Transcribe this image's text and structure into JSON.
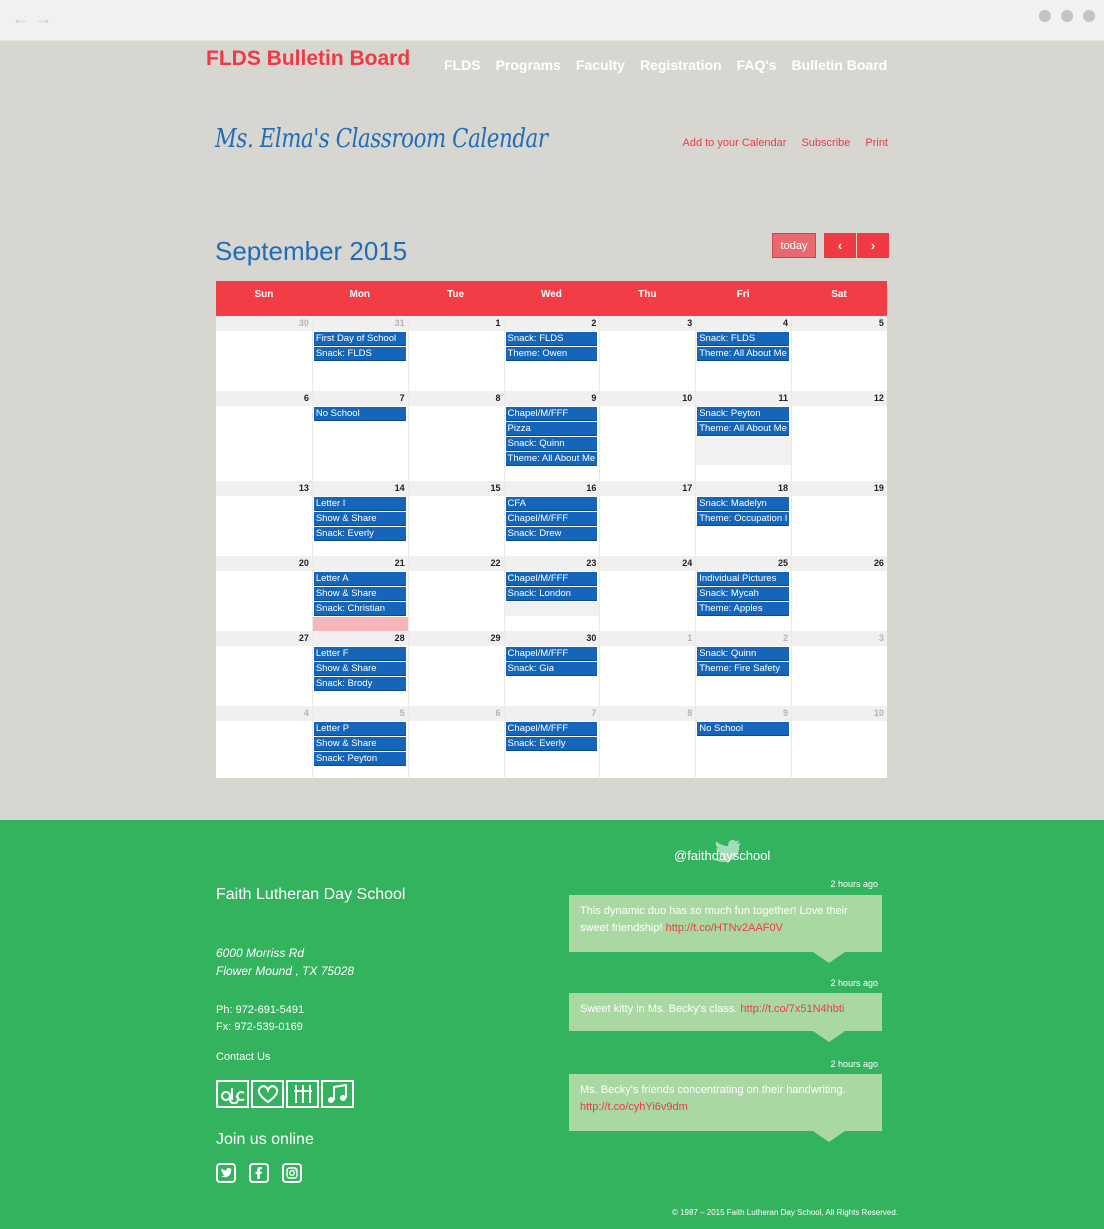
{
  "browser": {
    "back_icon": "←",
    "forward_icon": "→"
  },
  "header": {
    "site_title": "FLDS Bulletin Board",
    "nav": [
      "FLDS",
      "Programs",
      "Faculty",
      "Registration",
      "FAQ's",
      "Bulletin Board"
    ]
  },
  "page": {
    "heading": "Ms. Elma's Classroom Calendar",
    "links": [
      "Add to your Calendar",
      "Subscribe",
      "Print"
    ]
  },
  "calendar": {
    "month": "September 2015",
    "today_label": "today",
    "prev_label": "‹",
    "next_label": "›",
    "days_of_week": [
      "Sun",
      "Mon",
      "Tue",
      "Wed",
      "Thu",
      "Fri",
      "Sat"
    ],
    "weeks": [
      [
        {
          "n": "30",
          "other": true,
          "events": []
        },
        {
          "n": "31",
          "other": true,
          "events": [
            "First Day of School",
            "Snack: FLDS"
          ]
        },
        {
          "n": "1",
          "events": []
        },
        {
          "n": "2",
          "events": [
            "Snack: FLDS",
            "Theme: Owen"
          ]
        },
        {
          "n": "3",
          "events": []
        },
        {
          "n": "4",
          "events": [
            "Snack: FLDS",
            "Theme: All About Me"
          ]
        },
        {
          "n": "5",
          "events": []
        }
      ],
      [
        {
          "n": "6",
          "events": []
        },
        {
          "n": "7",
          "events": [
            "No School"
          ]
        },
        {
          "n": "8",
          "events": []
        },
        {
          "n": "9",
          "events": [
            "Chapel/M/FFF",
            "Pizza",
            "Snack: Quinn",
            "Theme: All About Me"
          ]
        },
        {
          "n": "10",
          "events": []
        },
        {
          "n": "11",
          "events": [
            "Snack: Peyton",
            "Theme: All About Me"
          ]
        },
        {
          "n": "12",
          "events": []
        }
      ],
      [
        {
          "n": "13",
          "events": []
        },
        {
          "n": "14",
          "events": [
            "Letter I",
            "Show & Share",
            "Snack: Everly"
          ]
        },
        {
          "n": "15",
          "events": []
        },
        {
          "n": "16",
          "events": [
            "CFA",
            "Chapel/M/FFF",
            "Snack: Drew"
          ]
        },
        {
          "n": "17",
          "events": []
        },
        {
          "n": "18",
          "events": [
            "Snack: Madelyn",
            "Theme: Occupation I"
          ]
        },
        {
          "n": "19",
          "events": []
        }
      ],
      [
        {
          "n": "20",
          "events": []
        },
        {
          "n": "21",
          "events": [
            "Letter A",
            "Show & Share",
            "Snack: Christian"
          ]
        },
        {
          "n": "22",
          "events": []
        },
        {
          "n": "23",
          "events": [
            "Chapel/M/FFF",
            "Snack: London"
          ]
        },
        {
          "n": "24",
          "events": []
        },
        {
          "n": "25",
          "events": [
            "Individual Pictures",
            "Snack: Mycah",
            "Theme: Apples"
          ]
        },
        {
          "n": "26",
          "events": []
        }
      ],
      [
        {
          "n": "27",
          "events": []
        },
        {
          "n": "28",
          "events": [
            "Letter F",
            "Show & Share",
            "Snack: Brody"
          ]
        },
        {
          "n": "29",
          "events": []
        },
        {
          "n": "30",
          "events": [
            "Chapel/M/FFF",
            "Snack: Gia"
          ]
        },
        {
          "n": "1",
          "other": true,
          "events": []
        },
        {
          "n": "2",
          "other": true,
          "events": [
            "Snack: Quinn",
            "Theme: Fire Safety"
          ]
        },
        {
          "n": "3",
          "other": true,
          "events": []
        }
      ],
      [
        {
          "n": "4",
          "other": true,
          "events": []
        },
        {
          "n": "5",
          "other": true,
          "events": [
            "Letter P",
            "Show & Share",
            "Snack: Peyton"
          ]
        },
        {
          "n": "6",
          "other": true,
          "events": []
        },
        {
          "n": "7",
          "other": true,
          "events": [
            "Chapel/M/FFF",
            "Snack: Everly"
          ]
        },
        {
          "n": "8",
          "other": true,
          "events": []
        },
        {
          "n": "9",
          "other": true,
          "events": [
            "No School"
          ]
        },
        {
          "n": "10",
          "other": true,
          "events": []
        }
      ]
    ]
  },
  "footer": {
    "school_name": "Faith Lutheran Day School",
    "address_line1": "6000 Morriss Rd",
    "address_line2": "Flower Mound , TX  75028",
    "phone": "Ph: 972-691-5491",
    "fax": "Fx: 972-539-0169",
    "contact": "Contact Us",
    "join": "Join us online",
    "twitter_handle": "@faithdayschool",
    "tweets": [
      {
        "time": "2 hours ago",
        "text": "This dynamic duo has so much fun together! Love their sweet friendship! ",
        "link": "http://t.co/HTNv2AAF0V"
      },
      {
        "time": "2 hours ago",
        "text": "Sweet kitty in Ms. Becky's class. ",
        "link": "http://t.co/7x51N4hbti"
      },
      {
        "time": "2 hours ago",
        "text": "Ms. Becky's friends concentrating on their handwriting. ",
        "link": "http://t.co/cyhYi6v9dm"
      }
    ],
    "copyright": "© 1987 – 2015 Faith Lutheran Day School, All Rights Reserved."
  },
  "colors": {
    "accent_red": "#ef3a44",
    "event_blue": "#1566ba",
    "heading_blue": "#1e6dbb",
    "footer_green": "#34b35f",
    "page_bg": "#d8d6d1"
  }
}
